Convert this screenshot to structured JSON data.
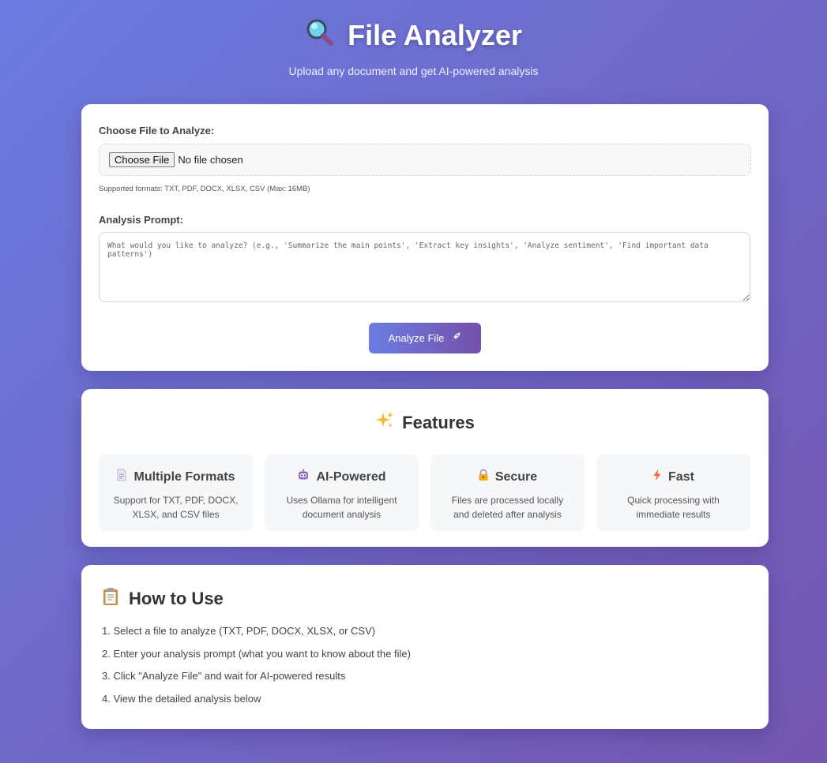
{
  "header": {
    "title": "File Analyzer",
    "title_icon": "magnifying-glass-icon",
    "subtitle": "Upload any document and get AI-powered analysis"
  },
  "upload": {
    "file_label": "Choose File to Analyze:",
    "choose_button": "Choose File",
    "file_status": "No file chosen",
    "hint": "Supported formats: TXT, PDF, DOCX, XLSX, CSV (Max: 16MB)",
    "prompt_label": "Analysis Prompt:",
    "prompt_value": "",
    "prompt_placeholder": "What would you like to analyze? (e.g., 'Summarize the main points', 'Extract key insights', 'Analyze sentiment', 'Find important data patterns')",
    "analyze_button": "Analyze File",
    "analyze_icon": "rocket-icon"
  },
  "features": {
    "title": "Features",
    "title_icon": "sparkles-icon",
    "items": [
      {
        "icon": "document-icon",
        "title": "Multiple Formats",
        "desc": "Support for TXT, PDF, DOCX, XLSX, and CSV files"
      },
      {
        "icon": "robot-icon",
        "title": "AI-Powered",
        "desc": "Uses Ollama for intelligent document analysis"
      },
      {
        "icon": "lock-icon",
        "title": "Secure",
        "desc": "Files are processed locally and deleted after analysis"
      },
      {
        "icon": "lightning-icon",
        "title": "Fast",
        "desc": "Quick processing with immediate results"
      }
    ]
  },
  "howto": {
    "title": "How to Use",
    "title_icon": "clipboard-icon",
    "steps": [
      "1. Select a file to analyze (TXT, PDF, DOCX, XLSX, or CSV)",
      "2. Enter your analysis prompt (what you want to know about the file)",
      "3. Click \"Analyze File\" and wait for AI-powered results",
      "4. View the detailed analysis below"
    ]
  },
  "colors": {
    "background_start": "#6b7be0",
    "background_end": "#7456b0",
    "button_start": "#6a7de2",
    "button_end": "#7650aa"
  }
}
